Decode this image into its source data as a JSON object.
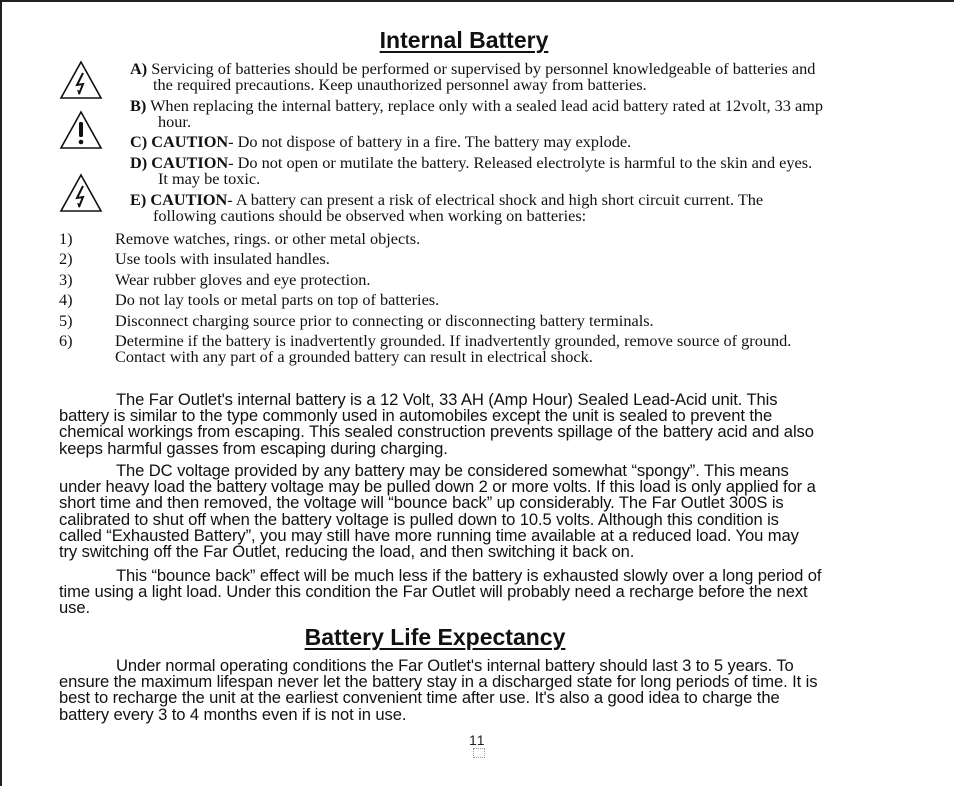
{
  "sections": {
    "internal_battery": {
      "title": "Internal Battery",
      "warnings": [
        {
          "label": "A)",
          "caution": "",
          "text": "Servicing of batteries should be performed or supervised by personnel knowledgeable of batteries and",
          "cont": "the required precautions. Keep unauthorized personnel away from batteries."
        },
        {
          "label": "B)",
          "caution": "",
          "text": "When replacing the internal battery, replace only with a sealed lead acid battery rated at 12volt, 33 amp",
          "cont": "hour."
        },
        {
          "label": "C)",
          "caution": "CAUTION",
          "text": "- Do not dispose of battery in a fire. The battery may explode.",
          "cont": ""
        },
        {
          "label": "D)",
          "caution": "CAUTION",
          "text": "- Do not open or mutilate the battery. Released electrolyte is harmful to the skin and eyes.",
          "cont": "It may be toxic."
        },
        {
          "label": "E)",
          "caution": "CAUTION",
          "text": "- A battery can present a risk of electrical shock and high short circuit current. The",
          "cont": "following cautions should be observed when working on batteries:"
        }
      ],
      "icons": [
        "electrical-shock-warning-icon",
        "caution-exclamation-icon",
        "electrical-shock-warning-icon"
      ],
      "precautions": [
        {
          "num": "1)",
          "text": "Remove watches, rings. or other metal objects."
        },
        {
          "num": "2)",
          "text": "Use tools with insulated handles."
        },
        {
          "num": "3)",
          "text": "Wear rubber gloves and eye protection."
        },
        {
          "num": "4)",
          "text": "Do not lay tools or metal parts on top of batteries."
        },
        {
          "num": "5)",
          "text": "Disconnect charging source prior to connecting or disconnecting battery terminals."
        },
        {
          "num": "6)",
          "text": "Determine if the battery is inadvertently grounded. If inadvertently grounded, remove source of ground.",
          "cont": "Contact with any part of a grounded battery can result in electrical shock."
        }
      ],
      "paragraphs": [
        {
          "lines": [
            "The Far Outlet's internal battery is a 12 Volt, 33 AH (Amp Hour) Sealed Lead-Acid unit. This",
            "battery is similar to the type commonly used in automobiles except the unit is sealed to prevent the",
            "chemical workings from escaping. This sealed construction prevents spillage of the battery acid and also",
            "keeps harmful gasses from escaping during charging."
          ]
        },
        {
          "lines": [
            "The DC voltage provided by any battery may be considered somewhat “spongy”. This means",
            "under heavy load the battery voltage may be pulled down 2 or more volts. If this load is only applied for a",
            "short time and then removed, the voltage will “bounce back” up considerably. The Far Outlet 300S is",
            "calibrated to shut off when the battery voltage is pulled down to 10.5 volts. Although this condition is",
            "called “Exhausted Battery”, you may still have more running time available at a reduced load. You may",
            "try switching off the Far Outlet, reducing the load, and then switching it back on."
          ]
        },
        {
          "lines": [
            "This “bounce back” effect will be much less if the battery is exhausted slowly over a long period of",
            "time using a light load. Under this condition the Far Outlet will probably need a recharge before the next",
            "use."
          ]
        }
      ]
    },
    "battery_life": {
      "title": "Battery Life Expectancy",
      "paragraphs": [
        {
          "lines": [
            "Under normal operating conditions the Far Outlet's internal battery should last 3 to 5 years. To",
            "ensure the maximum lifespan never let the battery stay in a discharged state for long periods of time. It is",
            "best to recharge the unit at the earliest convenient time after use. It's also a good idea to charge the",
            "battery every 3 to 4 months even if is not in use."
          ]
        }
      ]
    }
  },
  "footer": {
    "page_number": "11"
  }
}
